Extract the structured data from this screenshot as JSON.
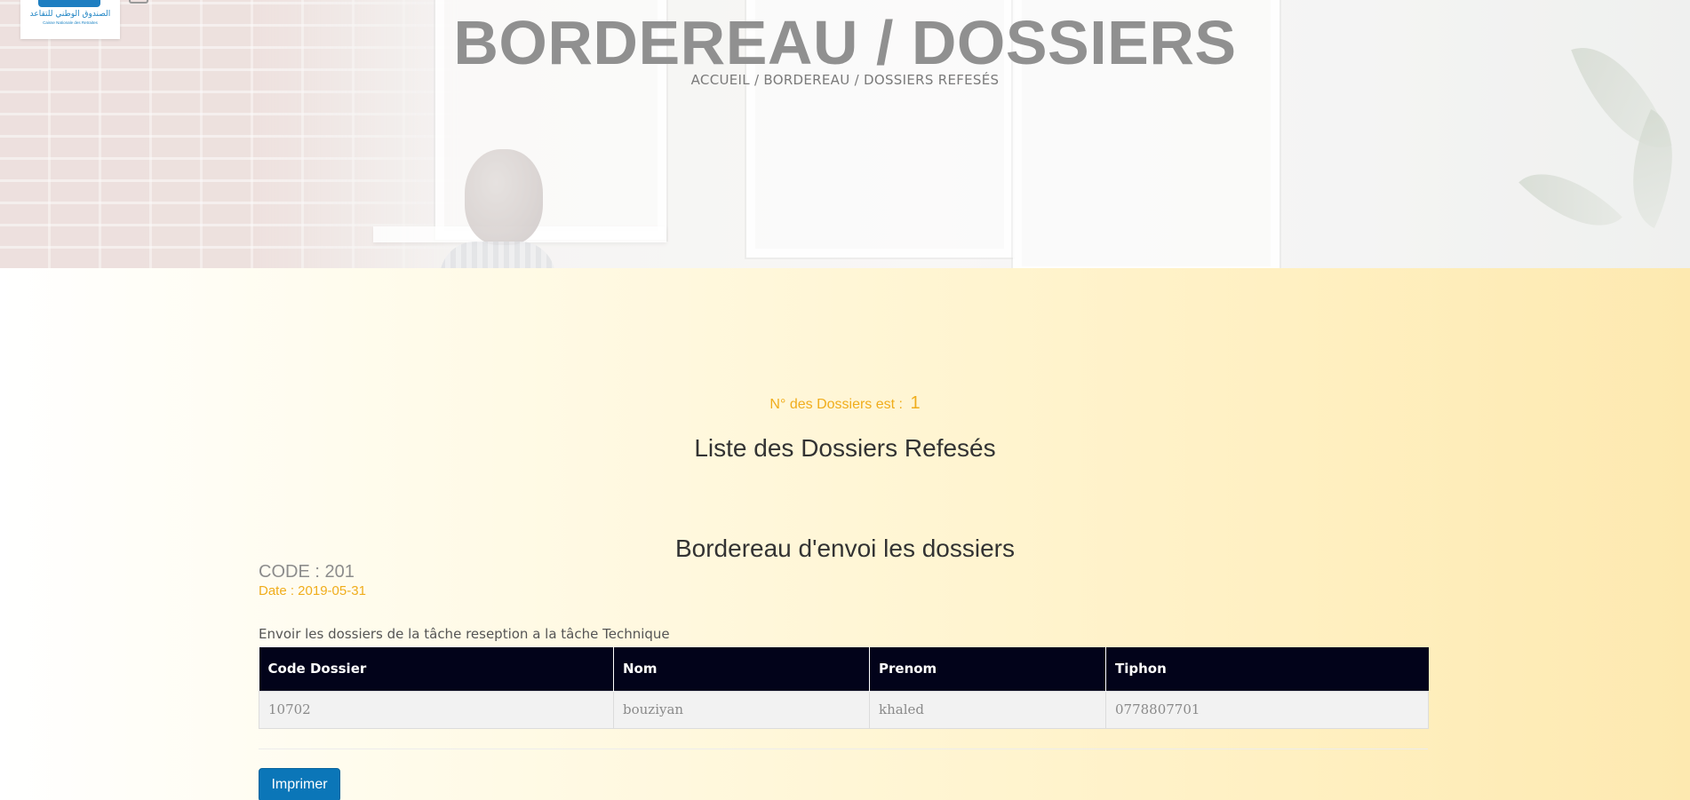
{
  "header": {
    "title": "BORDEREAU / DOSSIERS",
    "breadcrumb": "ACCUEIL / BORDEREAU / DOSSIERS REFESÉS",
    "logo": {
      "arabic_text": "الصندوق الوطني للتقاعد",
      "french_text": "Caisse Nationale des Retraites"
    }
  },
  "summary": {
    "count_label": "N° des Dossiers est :",
    "count_value": "1",
    "list_title": "Liste des Dossiers Refesés"
  },
  "bordereau": {
    "title": "Bordereau d'envoi les dossiers",
    "code": "CODE : 201",
    "date": "Date : 2019-05-31",
    "description": "Envoir les dossiers de la tâche reseption a la tâche Technique"
  },
  "table": {
    "columns": [
      "Code Dossier",
      "Nom",
      "Prenom",
      "Tiphon"
    ],
    "rows": [
      [
        "10702",
        "bouziyan",
        "khaled",
        "0778807701"
      ]
    ]
  },
  "actions": {
    "print_label": "Imprimer"
  },
  "colors": {
    "accent_orange": "#f0ad1c",
    "table_header": "#02031a",
    "button_blue": "#0b76b8"
  }
}
